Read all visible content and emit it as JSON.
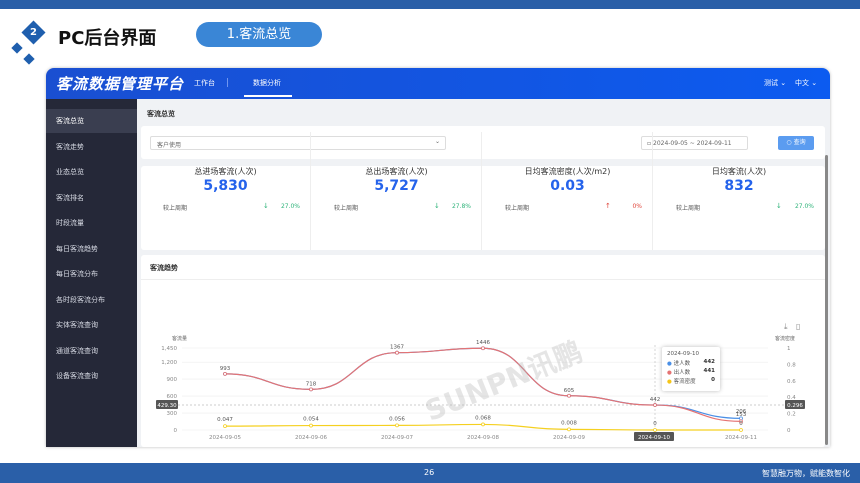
{
  "slide": {
    "number": "2",
    "title": "PC后台界面",
    "section": "1.客流总览",
    "page": "26",
    "slogan": "智慧融万物，赋能数智化"
  },
  "app": {
    "logo": "客流数据管理平台",
    "nav": [
      "工作台",
      "数据分析"
    ],
    "user": "测试",
    "lang": "中文"
  },
  "sidebar": {
    "items": [
      "客流总览",
      "客流走势",
      "业态总览",
      "客流排名",
      "时段流量",
      "每日客流趋势",
      "每日客流分布",
      "各时段客流分布",
      "实体客流查询",
      "通道客流查询",
      "设备客流查询"
    ]
  },
  "page_title": "客流总览",
  "filter": {
    "select": "客户使用",
    "date_start": "2024-09-05",
    "date_sep": "~",
    "date_end": "2024-09-11",
    "query": "查询"
  },
  "stats": [
    {
      "label": "总进场客流(人次)",
      "value": "5,830",
      "compare": "较上周期",
      "dir": "↓",
      "pct": "27.0%",
      "color": "#2fb37a"
    },
    {
      "label": "总出场客流(人次)",
      "value": "5,727",
      "compare": "较上周期",
      "dir": "↓",
      "pct": "27.8%",
      "color": "#2fb37a"
    },
    {
      "label": "日均客流密度(人次/m2)",
      "value": "0.03",
      "compare": "较上周期",
      "dir": "↑",
      "pct": "0%",
      "color": "#e0463c"
    },
    {
      "label": "日均客流(人次)",
      "value": "832",
      "compare": "较上周期",
      "dir": "↓",
      "pct": "27.0%",
      "color": "#2fb37a"
    }
  ],
  "trend_title": "客流趋势",
  "watermark": "SUNPN讯鹏",
  "chart_data": {
    "type": "line",
    "x": [
      "2024-09-05",
      "2024-09-06",
      "2024-09-07",
      "2024-09-08",
      "2024-09-09",
      "2024-09-10",
      "2024-09-11"
    ],
    "ylabel_left": "客流量",
    "ylabel_right": "客流密度",
    "yticks_left": [
      "0",
      "300",
      "600",
      "900",
      "1,200",
      "1,450"
    ],
    "ylim_left": [
      0,
      1450
    ],
    "yticks_right": [
      "0",
      "0.2",
      "0.4",
      "0.6",
      "0.8",
      "1"
    ],
    "ylim_right": [
      0,
      1
    ],
    "series": [
      {
        "name": "进人数",
        "color": "#4a8fe6",
        "axis": "left",
        "values": [
          993,
          718,
          1367,
          1446,
          605,
          442,
          206
        ]
      },
      {
        "name": "出人数",
        "color": "#e57373",
        "axis": "left",
        "values": [
          993,
          718,
          1367,
          1446,
          605,
          441,
          153
        ]
      },
      {
        "name": "客流密度",
        "color": "#f5d020",
        "axis": "right",
        "values": [
          0.047,
          0.054,
          0.056,
          0.068,
          0.008,
          0,
          0
        ]
      }
    ],
    "data_labels": [
      "993",
      "718",
      "1367",
      "1446",
      "605",
      "442",
      "206",
      "153"
    ],
    "density_labels": [
      "0.047",
      "0.054",
      "0.056",
      "0.068",
      "0.008",
      "0",
      "0"
    ],
    "crosshair": {
      "left_value": "429.30",
      "right_value": "0.296",
      "x": "2024-09-10"
    },
    "tooltip": {
      "title": "2024-09-10",
      "rows": [
        {
          "name": "进人数",
          "value": "442",
          "color": "#4a8fe6"
        },
        {
          "name": "出人数",
          "value": "441",
          "color": "#e57373"
        },
        {
          "name": "客流密度",
          "value": "0",
          "color": "#f5c518"
        }
      ]
    },
    "grid": true
  }
}
